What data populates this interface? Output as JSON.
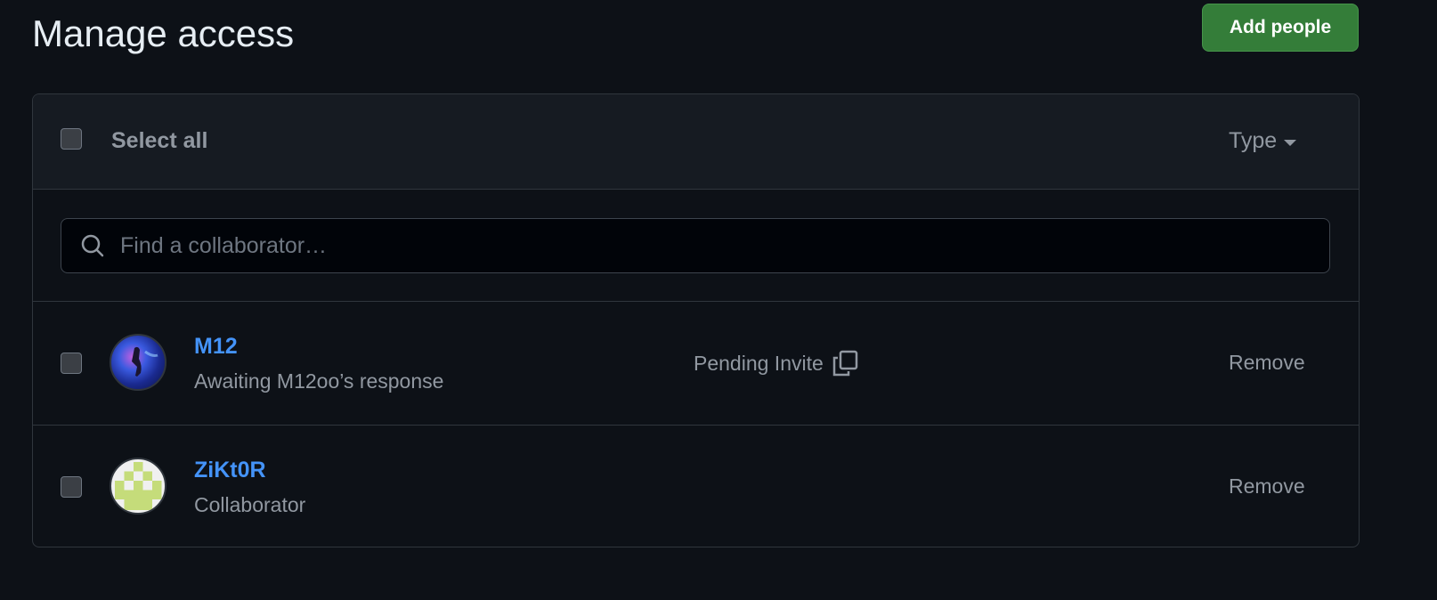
{
  "header": {
    "title": "Manage access",
    "add_button": "Add people"
  },
  "list": {
    "select_all": "Select all",
    "type_filter": "Type",
    "search_placeholder": "Find a collaborator…",
    "members": [
      {
        "name": "M12",
        "subtitle": "Awaiting M12oo’s response",
        "status": "Pending Invite",
        "action": "Remove"
      },
      {
        "name": "ZiKt0R",
        "subtitle": "Collaborator",
        "action": "Remove"
      }
    ]
  },
  "colors": {
    "accent": "#4493f8",
    "button": "#347d39",
    "identicon": "#c5dc7a"
  }
}
